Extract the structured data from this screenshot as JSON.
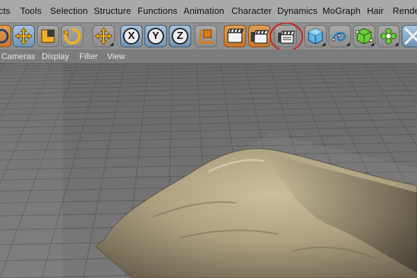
{
  "menubar": {
    "items": [
      "cts",
      "Tools",
      "Selection",
      "Structure",
      "Functions",
      "Animation",
      "Character",
      "Dynamics",
      "MoGraph",
      "Hair",
      "Rende"
    ]
  },
  "toolbar": {
    "icons": [
      "live-selection-icon",
      "move-icon",
      "scale-icon",
      "rotate-icon",
      "move-axis-icon",
      "x-axis-icon",
      "y-axis-icon",
      "z-axis-icon",
      "coordinate-system-icon",
      "render-view-icon",
      "render-picture-viewer-icon",
      "render-settings-icon",
      "cube-icon",
      "spline-icon",
      "nurbs-icon",
      "cloner-icon",
      "deformer-icon"
    ],
    "x_label": "X",
    "y_label": "Y",
    "z_label": "Z",
    "highlight_color": "#d42020"
  },
  "submenu": {
    "items": [
      "Cameras",
      "Display",
      "Filter",
      "View"
    ]
  },
  "viewport": {
    "object": "pillow",
    "grid_color": "#5a5a5a",
    "floor_color": "#727272",
    "pillow_color": "#b5a888"
  }
}
